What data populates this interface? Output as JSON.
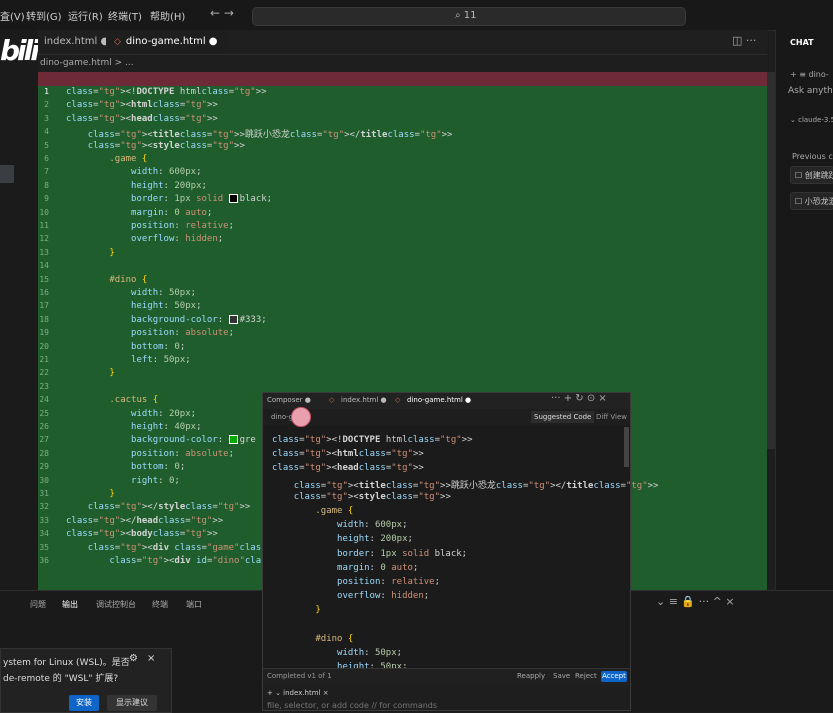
{
  "menubar": {
    "items": [
      "査(V)",
      "转到(G)",
      "运行(R)",
      "终端(T)",
      "帮助(H)"
    ],
    "nav_arrows": "←  →",
    "search_text": "⌕ 11"
  },
  "tabs": [
    {
      "label": "index.html ●"
    },
    {
      "label": "dino-game.html ●"
    }
  ],
  "tab_actions": "◫  ···",
  "logo_text": "bili",
  "breadcrumb": "dino-game.html > ...",
  "editor": {
    "line_numbers": [
      "1",
      "2",
      "3",
      "4",
      "5",
      "6",
      "7",
      "8",
      "9",
      "10",
      "11",
      "12",
      "13",
      "14",
      "15",
      "16",
      "17",
      "18",
      "19",
      "20",
      "21",
      "22",
      "23",
      "24",
      "25",
      "26",
      "27",
      "28",
      "29",
      "30",
      "31",
      "32",
      "33",
      "34",
      "35",
      "36"
    ],
    "lines": [
      "<!DOCTYPE html>",
      "<html>",
      "<head>",
      "    <title>跳跃小恐龙</title>",
      "    <style>",
      "        .game {",
      "            width: 600px;",
      "            height: 200px;",
      "            border: 1px solid black;",
      "            margin: 0 auto;",
      "            position: relative;",
      "            overflow: hidden;",
      "        }",
      "",
      "        #dino {",
      "            width: 50px;",
      "            height: 50px;",
      "            background-color: #333;",
      "            position: absolute;",
      "            bottom: 0;",
      "            left: 50px;",
      "        }",
      "",
      "        .cactus {",
      "            width: 20px;",
      "            height: 40px;",
      "            background-color: gre",
      "            position: absolute;",
      "            bottom: 0;",
      "            right: 0;",
      "        }",
      "    </style>",
      "</head>",
      "<body>",
      "    <div class=\"game\">",
      "        <div id=\"dino\"></div>"
    ]
  },
  "chat": {
    "title": "CHAT",
    "new_chip": "+ ≡ dino-",
    "placeholder": "Ask anythin",
    "model": "⌄ claude-3.5",
    "previous_label": "Previous c",
    "history": [
      "创建跳跃",
      "小恐龙游"
    ]
  },
  "panel": {
    "tabs": [
      "问题",
      "输出",
      "调试控制台",
      "终端",
      "端口"
    ],
    "actions": "⌄  ≡  🔒  ···  ^  ×"
  },
  "notification": {
    "line1": "ystem for Linux (WSL)。是否",
    "line2": "de-remote 的 \"WSL\" 扩展?",
    "install": "安装",
    "show_suggestions": "显示建议"
  },
  "composer": {
    "tabs": [
      "Composer ●",
      "index.html ●",
      "dino-game.html ●"
    ],
    "actions": "···  +  ↻  ⊙  ×",
    "file": "dino-g      ml",
    "suggested_code": "Suggested Code",
    "diff_view": "Diff View",
    "lines": [
      "<!DOCTYPE html>",
      "<html>",
      "<head>",
      "    <title>跳跃小恐龙</title>",
      "    <style>",
      "        .game {",
      "            width: 600px;",
      "            height: 200px;",
      "            border: 1px solid black;",
      "            margin: 0 auto;",
      "            position: relative;",
      "            overflow: hidden;",
      "        }",
      "",
      "        #dino {",
      "            width: 50px;",
      "            height: 50px;"
    ],
    "completed": "Completed v1 of 1",
    "reapply": "Reapply",
    "save": "Save",
    "reject": "Reject",
    "accept": "Accept",
    "context_chip": "+  ⌄ index.html ×",
    "input_placeholder": "file, selector, or add code // for commands"
  },
  "colors": {
    "diff_added": "#1f5d2c",
    "diff_removed": "#6e2a36",
    "accent": "#0e64c7"
  }
}
